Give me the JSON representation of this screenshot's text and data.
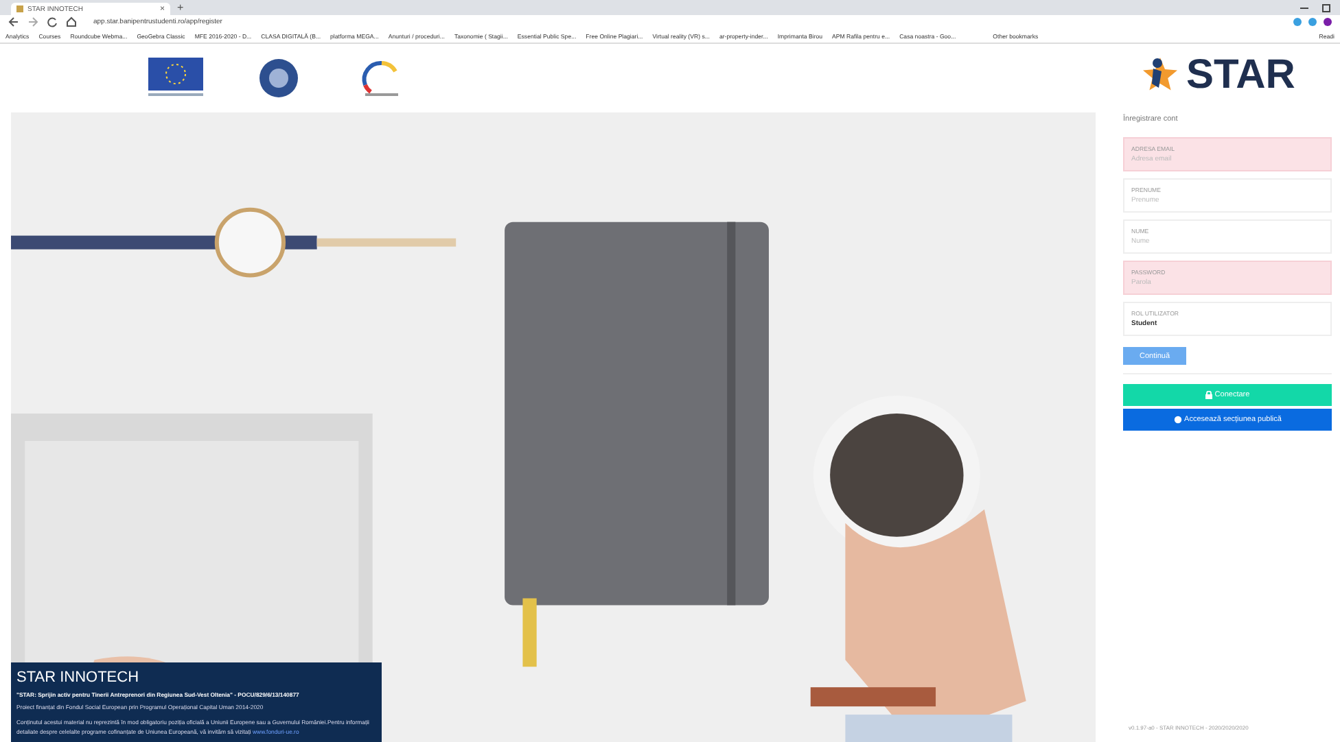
{
  "browser": {
    "tab_title": "STAR INNOTECH",
    "tab_close": "×",
    "new_tab": "+",
    "url": "app.star.banipentrustudenti.ro/app/register",
    "bookmarks": [
      "Analytics",
      "Courses",
      "Roundcube Webma...",
      "GeoGebra Classic",
      "MFE 2016-2020 - D...",
      "CLASA DIGITALĂ (B...",
      "platforma MEGA...",
      "Anunturi / proceduri...",
      "Taxonomie ( Stagii...",
      "Essential Public Spe...",
      "Free Online Plagiari...",
      "Virtual reality (VR) s...",
      "ar-property-inder...",
      "Imprimanta Birou",
      "APM Rafila pentru e...",
      "Casa noastra - Goo..."
    ],
    "other_bookmarks": "Other bookmarks",
    "reading_list": "Readi"
  },
  "logo": {
    "text": "STAR"
  },
  "form": {
    "title": "Înregistrare cont",
    "fields": [
      {
        "label": "ADRESA EMAIL",
        "placeholder": "Adresa email",
        "invalid": true
      },
      {
        "label": "PRENUME",
        "placeholder": "Prenume",
        "invalid": false
      },
      {
        "label": "NUME",
        "placeholder": "Nume",
        "invalid": false
      },
      {
        "label": "PASSWORD",
        "placeholder": "Parola",
        "invalid": true
      },
      {
        "label": "ROL UTILIZATOR",
        "value": "Student",
        "invalid": false
      }
    ],
    "continue_button": "Continuă",
    "login_button": "Conectare",
    "public_button": "Accesează secțiunea publică"
  },
  "info": {
    "title": "STAR INNOTECH",
    "project": "\"STAR: Sprijin activ pentru Tinerii Antreprenori din Regiunea Sud-Vest Oltenia\" - POCU/829/6/13/140877",
    "funding": "Proiect finanțat din Fondul Social European prin Programul Operațional Capital Uman 2014-2020",
    "disclaimer": "Conținutul acestui material nu reprezintă în mod obligatoriu poziția oficială a Uniunii Europene sau a Guvernului României.Pentru informații detaliate despre celelalte programe cofinanțate de Uniunea Europeană, vă invităm să vizitați",
    "link": "www.fonduri-ue.ro"
  },
  "footer": "v0.1.97-a0 - STAR INNOTECH - 2020/2020/2020"
}
